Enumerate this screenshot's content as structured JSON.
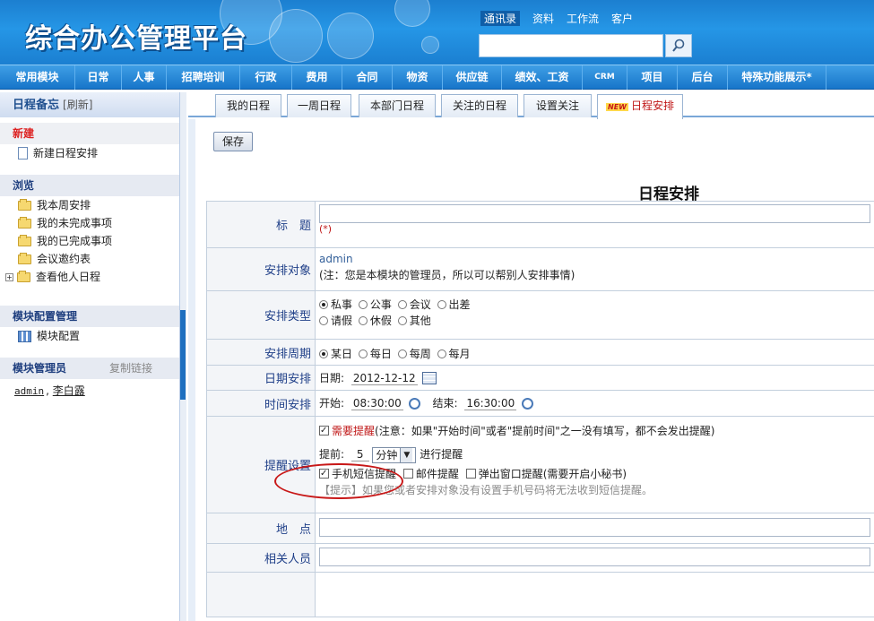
{
  "header": {
    "logo": "综合办公管理平台",
    "links": [
      "通讯录",
      "资料",
      "工作流",
      "客户"
    ],
    "search_placeholder": ""
  },
  "nav": [
    "常用模块",
    "日常",
    "人事",
    "招聘培训",
    "行政",
    "费用",
    "合同",
    "物资",
    "供应链",
    "绩效、工资",
    "CRM",
    "项目",
    "后台",
    "特殊功能展示*"
  ],
  "sidebar": {
    "title": "日程备忘",
    "refresh": "[刷新]",
    "new_section": "新建",
    "new_item": "新建日程安排",
    "browse_section": "浏览",
    "browse_items": [
      "我本周安排",
      "我的未完成事项",
      "我的已完成事项",
      "会议邀约表",
      "查看他人日程"
    ],
    "config_section": "模块配置管理",
    "config_item": "模块配置",
    "admin_section": "模块管理员",
    "copy_link": "复制链接",
    "admins": [
      "admin",
      "李白露"
    ]
  },
  "tabs": [
    "我的日程",
    "一周日程",
    "本部门日程",
    "关注的日程",
    "设置关注",
    "日程安排"
  ],
  "new_tag": "NEW",
  "toolbar": {
    "save": "保存"
  },
  "form": {
    "title": "日程安排",
    "title_label": "标　题",
    "title_required": "(*)",
    "target_label": "安排对象",
    "target_value": "admin",
    "target_note": "(注：您是本模块的管理员，所以可以帮别人安排事情)",
    "type_label": "安排类型",
    "types_row1": [
      "私事",
      "公事",
      "会议",
      "出差"
    ],
    "types_row2": [
      "请假",
      "休假",
      "其他"
    ],
    "cycle_label": "安排周期",
    "cycles": [
      "某日",
      "每日",
      "每周",
      "每月"
    ],
    "date_label": "日期安排",
    "date_prefix": "日期:",
    "date_value": "2012-12-12",
    "time_label": "时间安排",
    "start_prefix": "开始:",
    "start_value": "08:30:00",
    "end_prefix": "结束:",
    "end_value": "16:30:00",
    "remind_label": "提醒设置",
    "remind_need": "需要提醒",
    "remind_note": "(注意：如果\"开始时间\"或者\"提前时间\"之一没有填写，都不会发出提醒)",
    "ahead_prefix": "提前:",
    "ahead_value": "5",
    "ahead_unit": "分钟",
    "ahead_suffix": "进行提醒",
    "sms": "手机短信提醒",
    "email": "邮件提醒",
    "popup": "弹出窗口提醒(需要开启小秘书)",
    "tip": "【提示】如果您或者安排对象没有设置手机号码将无法收到短信提醒。",
    "place_label": "地　点",
    "people_label": "相关人员"
  }
}
